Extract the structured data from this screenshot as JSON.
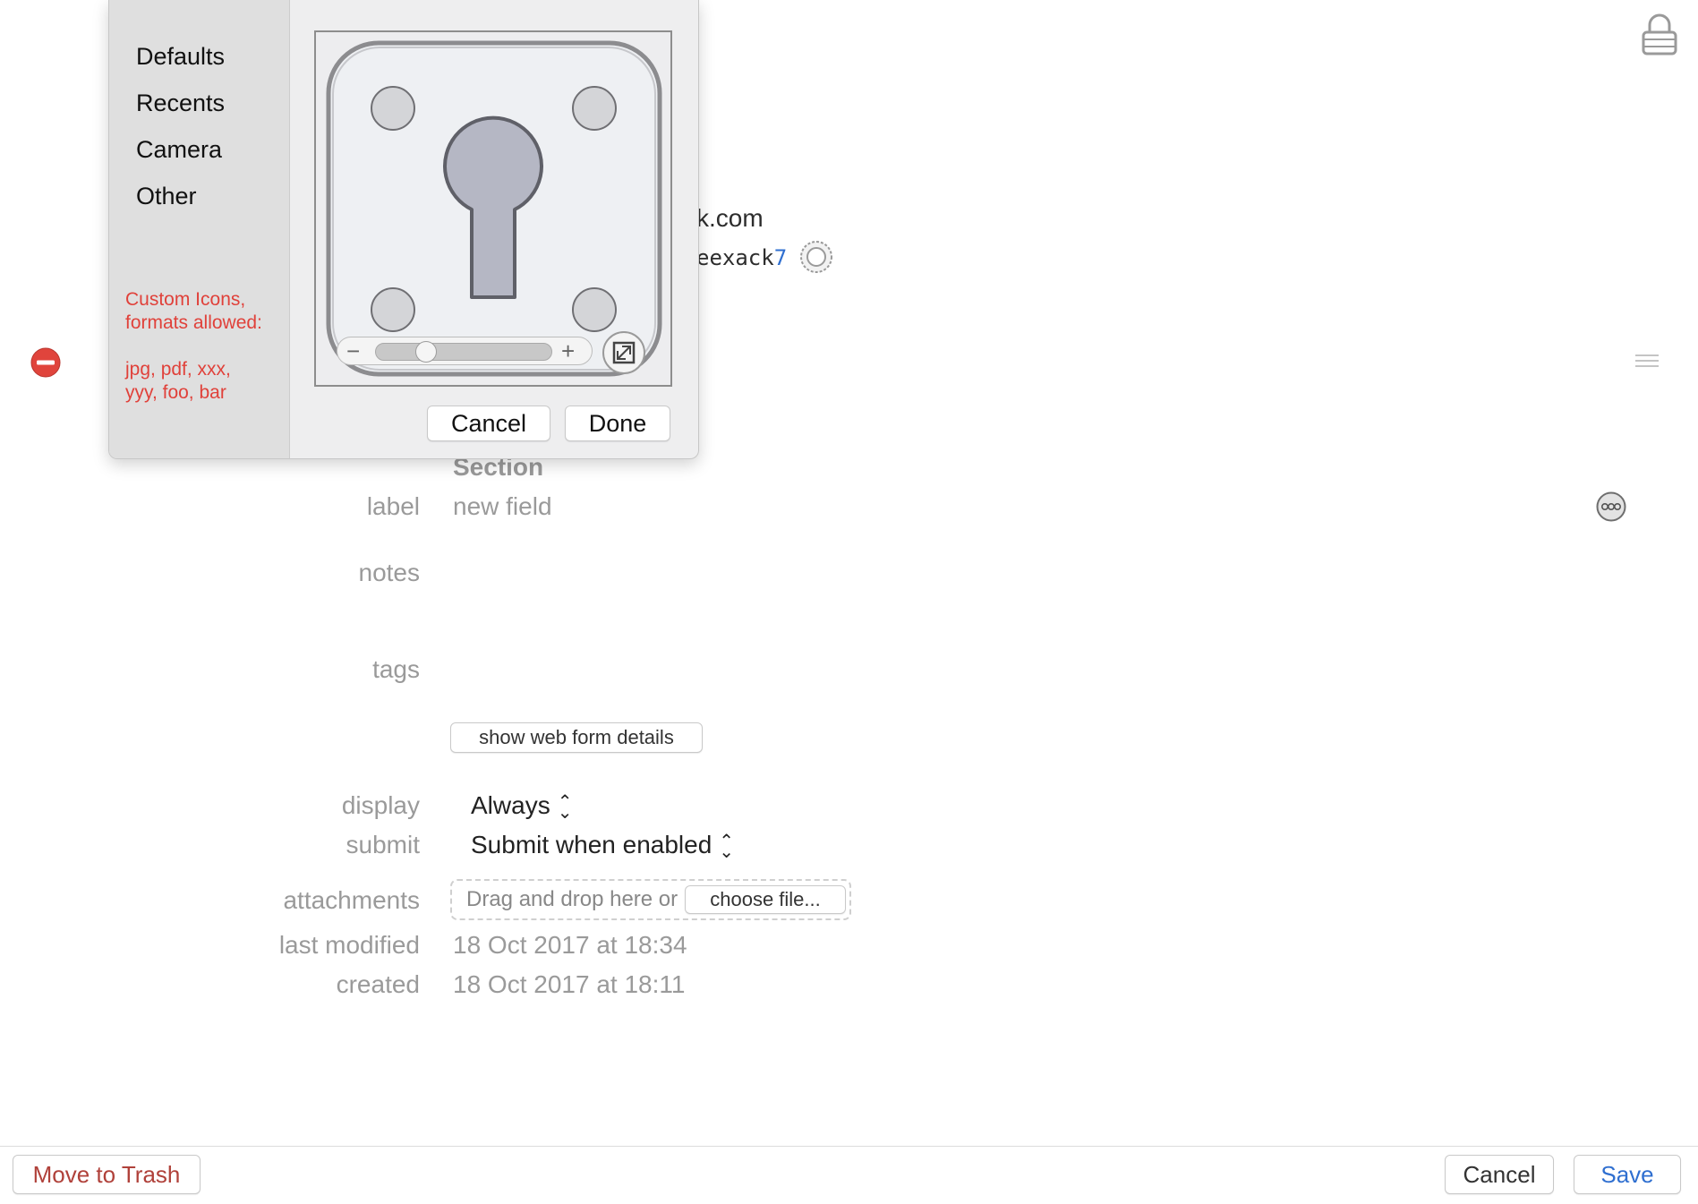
{
  "form": {
    "partial_url_suffix": "k.com",
    "partial_password_suffix": "eexack",
    "partial_password_digit": "7",
    "section_title": "Section",
    "label_field": {
      "label": "label",
      "value": "new field"
    },
    "notes_label": "notes",
    "tags_label": "tags",
    "web_form_button": "show web form details",
    "display": {
      "label": "display",
      "value": "Always"
    },
    "submit": {
      "label": "submit",
      "value": "Submit when enabled"
    },
    "attachments": {
      "label": "attachments",
      "drop_text": "Drag and drop here or",
      "choose_button": "choose file..."
    },
    "last_modified": {
      "label": "last modified",
      "value": "18 Oct 2017 at 18:34"
    },
    "created": {
      "label": "created",
      "value": "18 Oct 2017 at 18:11"
    }
  },
  "bottom_bar": {
    "trash_button": "Move to Trash",
    "cancel_button": "Cancel",
    "save_button": "Save"
  },
  "icon_picker": {
    "sidebar_items": [
      "Defaults",
      "Recents",
      "Camera",
      "Other"
    ],
    "custom_note_line1": "Custom Icons,",
    "custom_note_line2": "formats allowed:",
    "custom_note_line3": "jpg, pdf, xxx,",
    "custom_note_line4": "yyy, foo, bar",
    "zoom_minus": "−",
    "zoom_plus": "+",
    "zoom_level": 0.25,
    "cancel_button": "Cancel",
    "done_button": "Done"
  },
  "icons": {
    "lock": "lock-icon",
    "remove": "remove-field-icon",
    "drag": "drag-handle-icon",
    "more": "more-options-icon",
    "generator": "password-generator-icon",
    "keyhole": "keyhole-icon",
    "fit": "fit-to-frame-icon"
  },
  "colors": {
    "accent_blue": "#2f6fd0",
    "trash_red": "#b0413a",
    "note_red": "#e0413a",
    "remove_red": "#e0443c"
  }
}
